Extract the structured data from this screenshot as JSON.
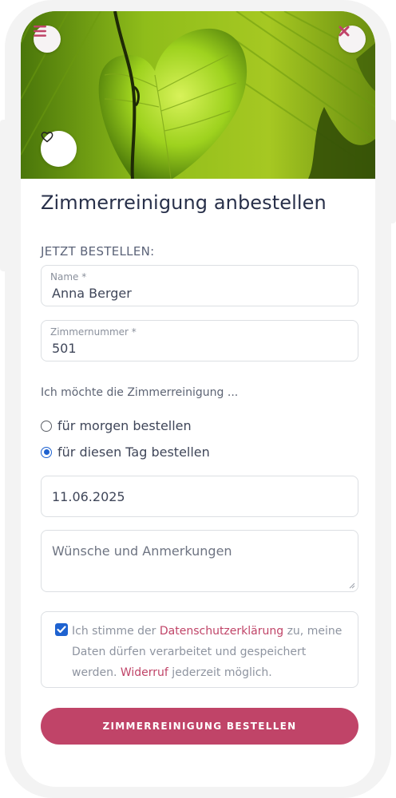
{
  "hero": {
    "image_alt": "heart-shaped green leaf",
    "menu_icon": "hamburger-icon",
    "close_icon": "close-icon",
    "favorite_icon": "heart-outline-icon"
  },
  "page": {
    "title": "Zimmerreinigung anbestellen",
    "section_label": "JETZT BESTELLEN:"
  },
  "form": {
    "name": {
      "label": "Name *",
      "value": "Anna Berger"
    },
    "room": {
      "label": "Zimmernummer *",
      "value": "501"
    },
    "helper_text": "Ich möchte die Zimmerreinigung ...",
    "options": [
      {
        "label": "für morgen bestellen",
        "checked": false
      },
      {
        "label": "für diesen Tag bestellen",
        "checked": true
      }
    ],
    "date_value": "11.06.2025",
    "remarks_placeholder": "Wünsche und Anmerkungen",
    "consent": {
      "checked": true,
      "text_1": "Ich stimme der ",
      "link_1": "Datenschutzerklärung",
      "text_2": " zu, meine Daten dürfen verarbeitet und gespeichert werden. ",
      "link_2": "Widerruf",
      "text_3": " jederzeit möglich."
    },
    "submit_label": "ZIMMERREINIGUNG BESTELLEN"
  },
  "colors": {
    "accent": "#c04468",
    "checkbox_blue": "#1e62d0",
    "title": "#28304a",
    "hero_green": "#7faa14"
  }
}
